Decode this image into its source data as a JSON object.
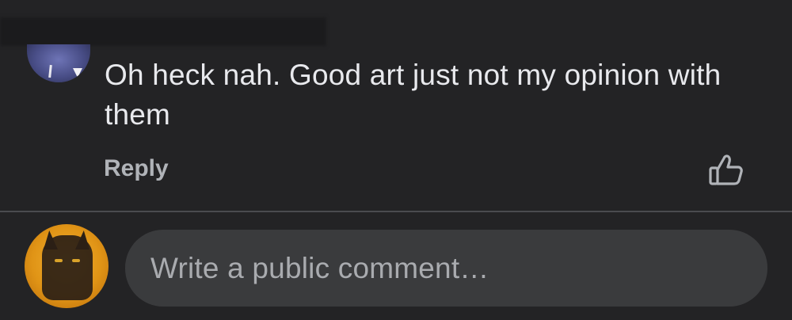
{
  "comment": {
    "text": "Oh heck nah. Good art just not my opinion with them",
    "reply_label": "Reply",
    "like_icon": "thumbs-up-icon"
  },
  "composer": {
    "placeholder": "Write a public comment…"
  },
  "colors": {
    "background": "#232325",
    "text_primary": "#e8e9ed",
    "text_secondary": "#b0b3b8",
    "input_background": "#3a3b3d",
    "divider": "#4a4b4f"
  }
}
